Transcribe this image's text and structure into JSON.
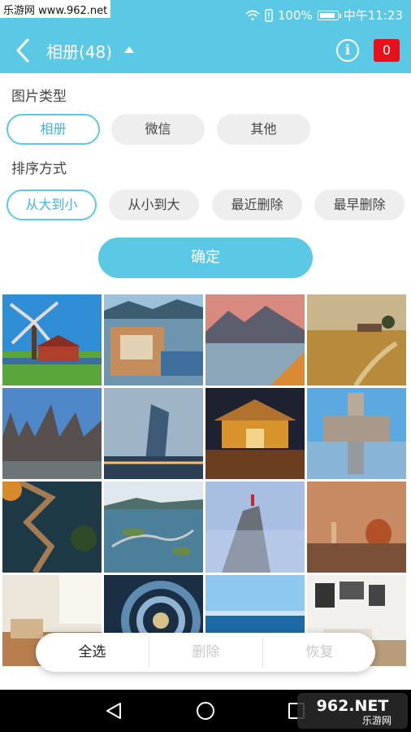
{
  "statusbar": {
    "carrier": "无服务",
    "watermark": "乐游网 www.962.net",
    "battery": "100%",
    "time": "中午11:23",
    "battery_level": 1.0
  },
  "header": {
    "title": "相册(48)",
    "badge_count": "0",
    "info_symbol": "i"
  },
  "filters": {
    "type_label": "图片类型",
    "type_options": [
      "相册",
      "微信",
      "其他"
    ],
    "type_selected": "相册",
    "sort_label": "排序方式",
    "sort_options": [
      "从大到小",
      "从小到大",
      "最近删除",
      "最早删除"
    ],
    "sort_selected": "从大到小",
    "confirm_label": "确定"
  },
  "photos": [
    {
      "subject": "windmill-farm"
    },
    {
      "subject": "coastal-town"
    },
    {
      "subject": "mountain-lake"
    },
    {
      "subject": "wheat-field"
    },
    {
      "subject": "gothic-square"
    },
    {
      "subject": "skyscraper-dusk"
    },
    {
      "subject": "temple-night"
    },
    {
      "subject": "palace-reflection"
    },
    {
      "subject": "zigzag-boardwalk"
    },
    {
      "subject": "ocean-road"
    },
    {
      "subject": "rock-pillar"
    },
    {
      "subject": "cathedral-dome"
    },
    {
      "subject": "living-room"
    },
    {
      "subject": "spiral-interior"
    },
    {
      "subject": "sea-horizon"
    },
    {
      "subject": "gallery-room"
    }
  ],
  "actions": {
    "select_all": "全选",
    "delete": "删除",
    "restore": "恢复"
  },
  "watermark_corner": {
    "top": "962.NET",
    "bottom": "乐游网"
  },
  "colors": {
    "accent": "#5bc8e6",
    "badge": "#e8101a"
  }
}
